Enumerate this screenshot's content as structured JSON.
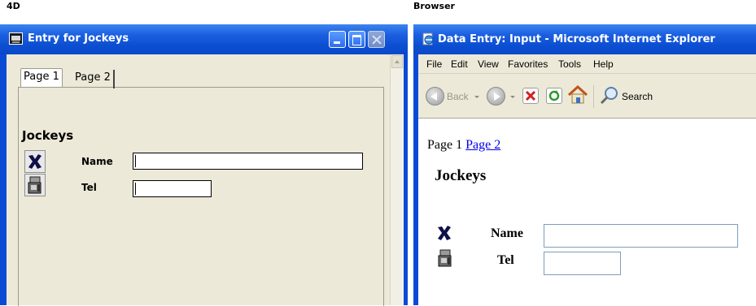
{
  "captions": {
    "left": "4D",
    "right": "Browser"
  },
  "window_4d": {
    "title": "Entry for Jockeys",
    "tabs": [
      {
        "label": "Page 1",
        "active": true
      },
      {
        "label": "Page 2",
        "active": false
      }
    ],
    "form_title": "Jockeys",
    "fields": [
      {
        "label": "Name",
        "value": ""
      },
      {
        "label": "Tel",
        "value": ""
      }
    ],
    "buttons": [
      {
        "icon": "delete-x-icon"
      },
      {
        "icon": "floppy-save-icon"
      }
    ]
  },
  "window_browser": {
    "title": "Data Entry: Input - Microsoft Internet Explorer",
    "menu": [
      "File",
      "Edit",
      "View",
      "Favorites",
      "Tools",
      "Help"
    ],
    "toolbar": {
      "back_label": "Back",
      "search_label": "Search"
    },
    "page_links": {
      "current": "Page 1",
      "link": "Page 2"
    },
    "form_title": "Jockeys",
    "fields": [
      {
        "label": "Name",
        "value": ""
      },
      {
        "label": "Tel",
        "value": ""
      }
    ]
  },
  "colors": {
    "title_bar": "#0a4bd6",
    "link": "#0000ee",
    "x_icon": "#101048"
  }
}
